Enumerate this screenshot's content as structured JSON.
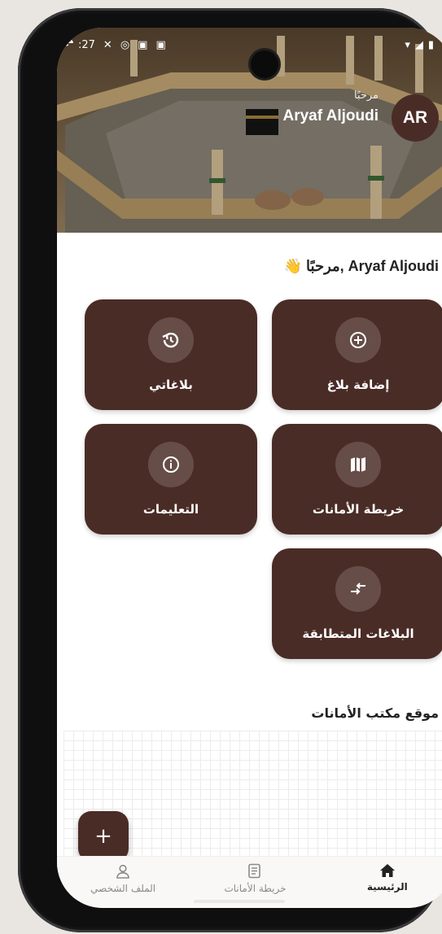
{
  "status_bar": {
    "time": ":27"
  },
  "header": {
    "greeting": "مرحبًا",
    "user_name": "Aryaf Aljoudi",
    "avatar_initials": "AR"
  },
  "welcome": {
    "text": "مرحبًا, Aryaf Aljoudi",
    "emoji": "👋"
  },
  "cards": {
    "add_report": {
      "label": "إضافة بلاغ",
      "icon": "plus-circle-icon"
    },
    "my_reports": {
      "label": "بلاغاتي",
      "icon": "history-icon"
    },
    "lost_map": {
      "label": "خريطة الأمانات",
      "icon": "map-icon"
    },
    "instructions": {
      "label": "التعليمات",
      "icon": "info-icon"
    },
    "matched_reports": {
      "label": "البلاغات المتطابقة",
      "icon": "swap-arrows-icon"
    }
  },
  "office_section": {
    "title": "موقع مكتب الأمانات"
  },
  "fab": {
    "label": "+"
  },
  "bottom_nav": {
    "home": "الرئيسية",
    "map": "خريطة الأمانات",
    "profile": "الملف الشخصي"
  },
  "colors": {
    "primary": "#4a2c26",
    "background": "#ffffff",
    "frame_bg": "#e9e6e1"
  }
}
